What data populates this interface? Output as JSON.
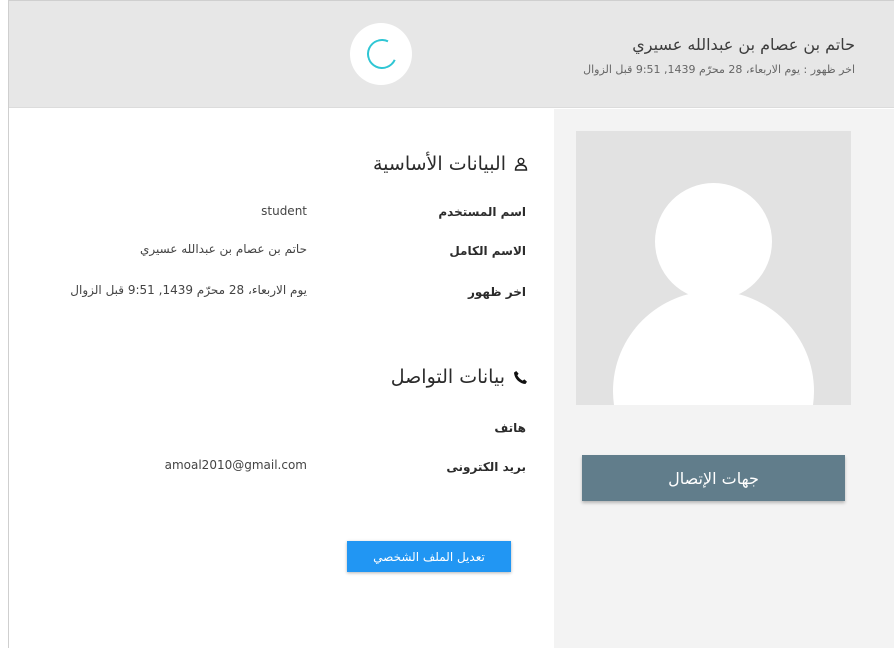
{
  "header": {
    "user_name": "حاتم بن عصام بن عبدالله عسيري",
    "last_seen": "اخر ظهور : يوم الاربعاء، 28 محرّم 1439, 9:51 قبل الزوال"
  },
  "sidebar": {
    "contacts_button": "جهات الإتصال"
  },
  "basic_info": {
    "title": "البيانات الأساسية",
    "icon": "user-icon",
    "fields": [
      {
        "label": "اسم المستخدم",
        "value": "student"
      },
      {
        "label": "الاسم الكامل",
        "value": "حاتم بن عصام بن عبدالله عسيري"
      },
      {
        "label": "اخر ظهور",
        "value": "يوم الاربعاء، 28 محرّم 1439, 9:51 قبل الزوال"
      }
    ]
  },
  "contact_info": {
    "title": "بيانات التواصل",
    "icon": "phone-icon",
    "fields": [
      {
        "label": "هاتف",
        "value": ""
      },
      {
        "label": "بريد الكترونى",
        "value": "amoal2010@gmail.com"
      }
    ]
  },
  "edit_profile_button": "تعديل الملف الشخصي",
  "colors": {
    "header_bg": "#e7e7e7",
    "sidebar_bg": "#f3f3f3",
    "contacts_button": "#617d8b",
    "edit_button": "#2196f3",
    "spinner": "#2fc6d4"
  }
}
